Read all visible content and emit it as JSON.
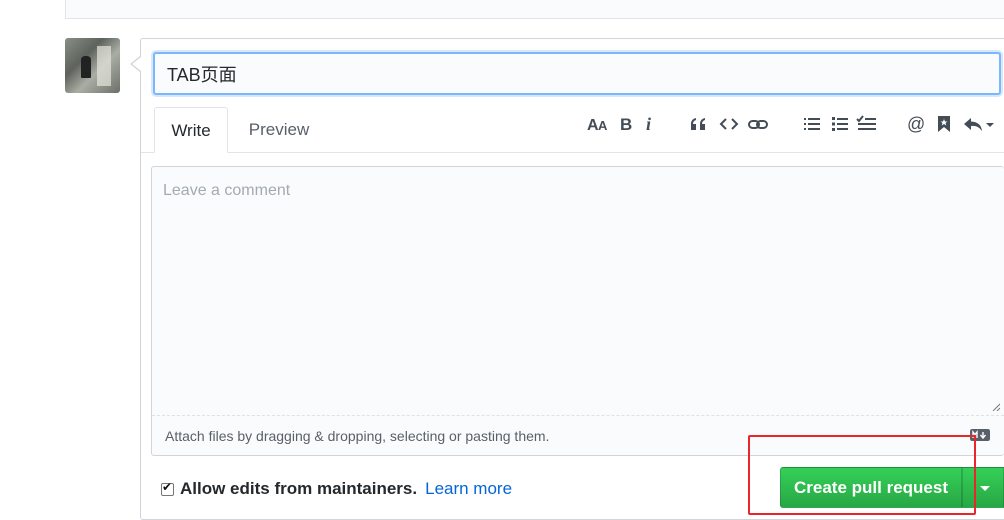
{
  "title_input": {
    "value": "TAB页面"
  },
  "tabs": [
    {
      "label": "Write",
      "active": true
    },
    {
      "label": "Preview",
      "active": false
    }
  ],
  "toolbar": {
    "icons": [
      "text-size-icon",
      "bold-icon",
      "italic-icon",
      "quote-icon",
      "code-icon",
      "link-icon",
      "bulleted-list-icon",
      "numbered-list-icon",
      "task-list-icon",
      "mention-icon",
      "saved-reply-icon",
      "reply-icon"
    ]
  },
  "comment": {
    "placeholder": "Leave a comment",
    "value": ""
  },
  "attach": {
    "text": "Attach files by dragging & dropping, selecting or pasting them."
  },
  "allow_edits": {
    "checked": true,
    "label": "Allow edits from maintainers.",
    "link": "Learn more"
  },
  "submit": {
    "label": "Create pull request"
  },
  "colors": {
    "accent_green": "#28a745",
    "link_blue": "#0366d6",
    "highlight_red": "#e8262c"
  }
}
